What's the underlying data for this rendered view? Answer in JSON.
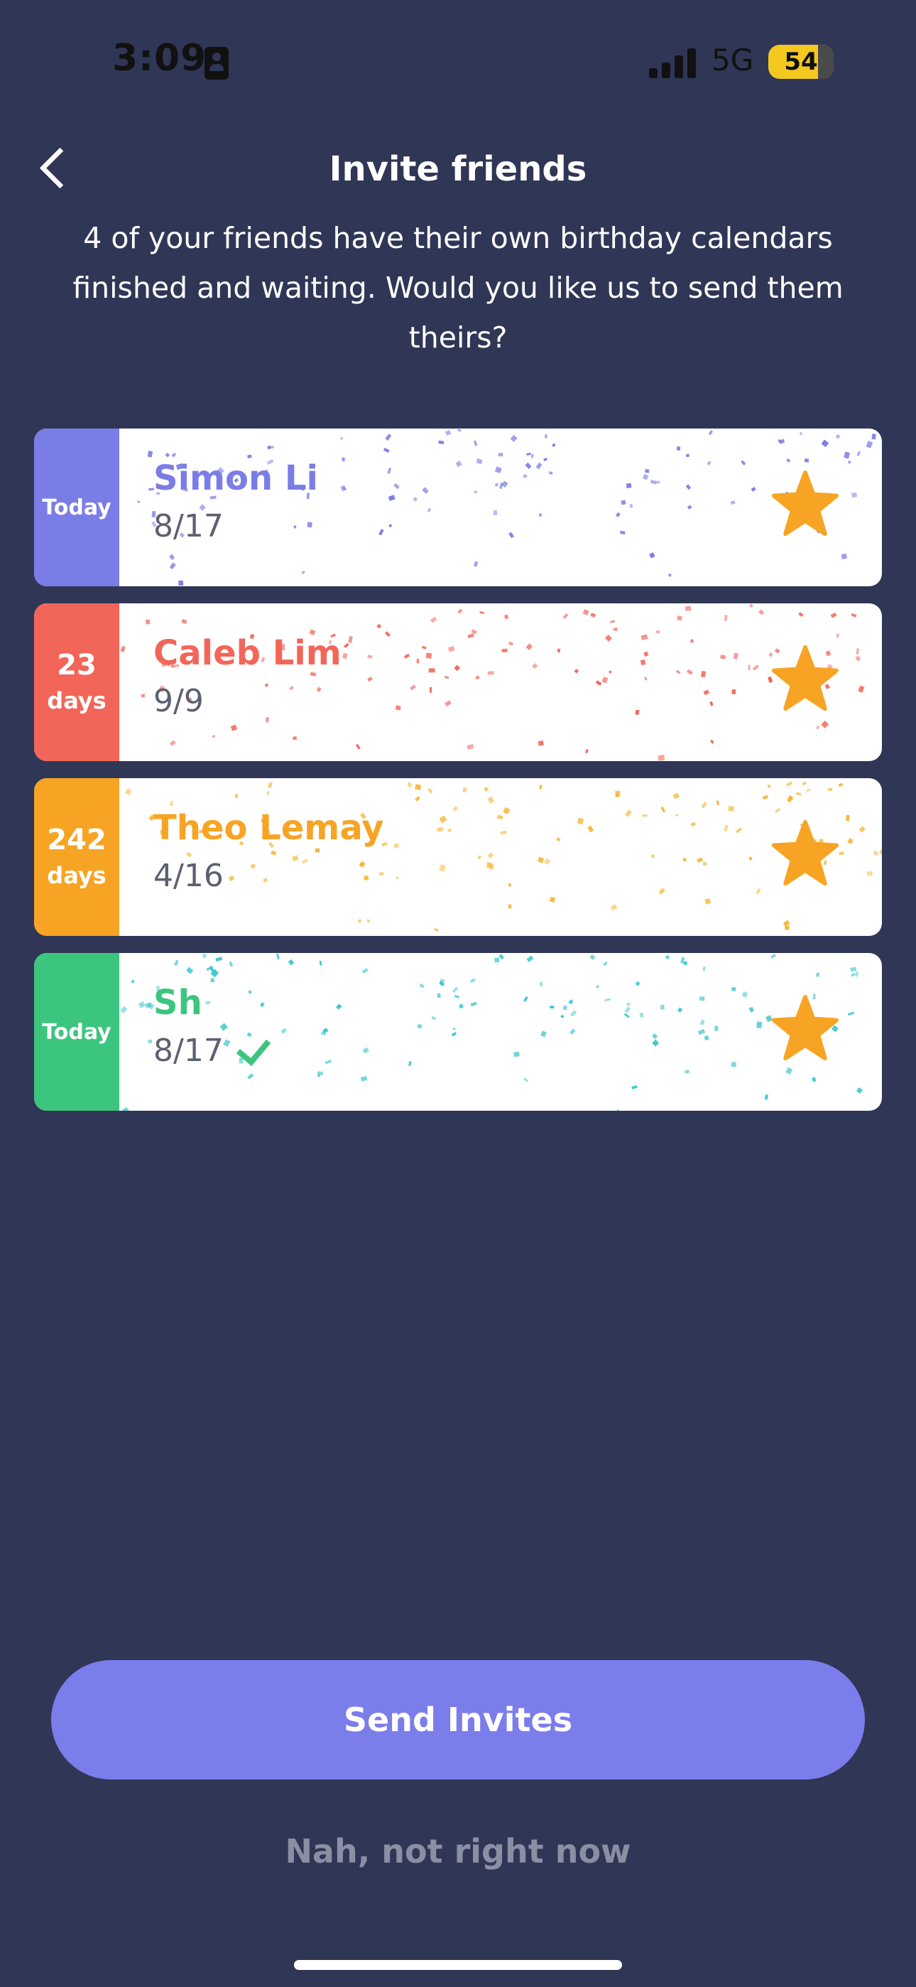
{
  "status_bar": {
    "time": "3:09",
    "network": "5G",
    "battery": "54"
  },
  "header": {
    "title": "Invite friends"
  },
  "subtitle": "4 of your friends have their own birthday calendars finished and waiting. Would you like us to send them theirs?",
  "friends": [
    {
      "countdown_top": "Today",
      "countdown_bottom": "",
      "name": "Simon Li",
      "date": "8/17",
      "color": "#7b7de6",
      "confetti_color": "#7b7de6",
      "checked": false
    },
    {
      "countdown_top": "23",
      "countdown_bottom": "days",
      "name": "Caleb Lim",
      "date": "9/9",
      "color": "#f2665a",
      "confetti_color": "#f2665a",
      "checked": false
    },
    {
      "countdown_top": "242",
      "countdown_bottom": "days",
      "name": "Theo Lemay",
      "date": "4/16",
      "color": "#f7a425",
      "confetti_color": "#f5b634",
      "checked": false
    },
    {
      "countdown_top": "Today",
      "countdown_bottom": "",
      "name": "Sh",
      "date": "8/17",
      "color": "#3cc57f",
      "confetti_color": "#3ec6cf",
      "checked": true
    }
  ],
  "icons": {
    "back": "chevron-left-icon",
    "favorite": "star-icon",
    "selected": "check-icon"
  },
  "colors": {
    "background": "#303655",
    "accent": "#7b7deb",
    "star": "#f7a425"
  },
  "actions": {
    "send_label": "Send Invites",
    "dismiss_label": "Nah, not right now"
  }
}
